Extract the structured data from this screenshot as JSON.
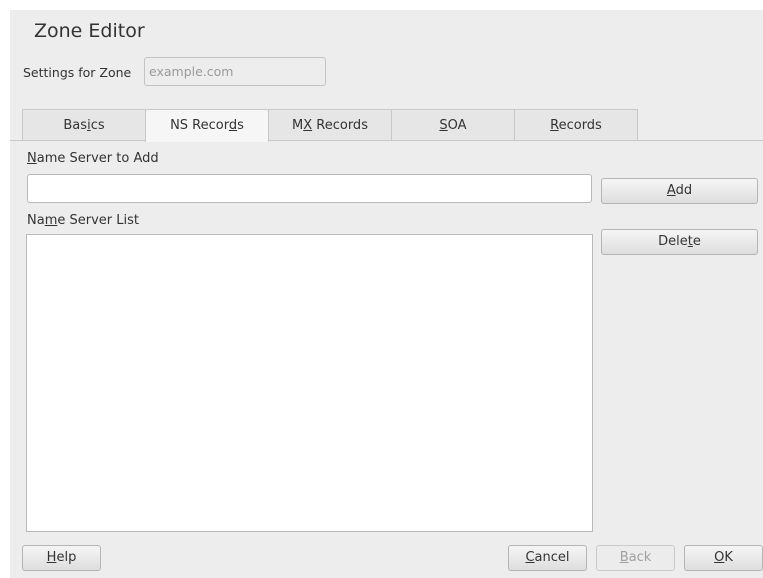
{
  "header": {
    "title": "Zone Editor",
    "zone_label": "Settings for Zone",
    "zone_value": "example.com"
  },
  "tabs": [
    {
      "label_pre": "Bas",
      "label_mn": "i",
      "label_post": "cs",
      "active": false
    },
    {
      "label_pre": "NS Recor",
      "label_mn": "d",
      "label_post": "s",
      "active": true
    },
    {
      "label_pre": "M",
      "label_mn": "X",
      "label_post": " Records",
      "active": false
    },
    {
      "label_pre": "",
      "label_mn": "S",
      "label_post": "OA",
      "active": false
    },
    {
      "label_pre": "",
      "label_mn": "R",
      "label_post": "ecords",
      "active": false
    }
  ],
  "ns": {
    "add_label_mn": "N",
    "add_label_post": "ame Server to Add",
    "add_value": "",
    "add_button_mn": "A",
    "add_button_post": "dd",
    "list_label_pre": "Na",
    "list_label_mn": "m",
    "list_label_post": "e Server List",
    "delete_pre": "Dele",
    "delete_mn": "t",
    "delete_post": "e",
    "items": []
  },
  "footer": {
    "help_mn": "H",
    "help_post": "elp",
    "cancel_mn": "C",
    "cancel_post": "ancel",
    "back_mn": "B",
    "back_post": "ack",
    "ok_mn": "O",
    "ok_post": "K"
  }
}
